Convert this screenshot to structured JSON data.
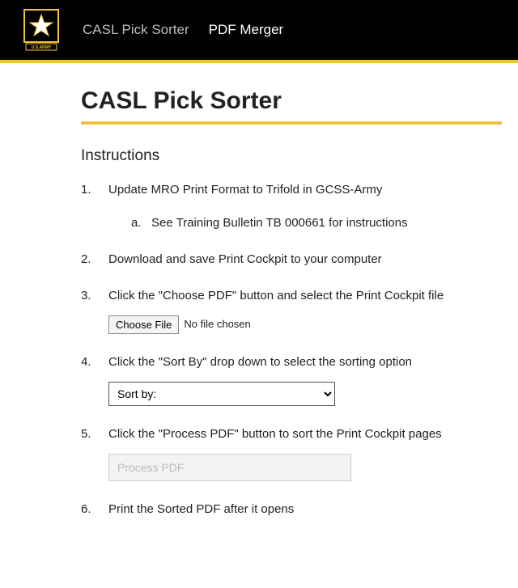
{
  "header": {
    "logo_label": "U.S.ARMY",
    "nav": [
      {
        "label": "CASL Pick Sorter",
        "active": false
      },
      {
        "label": "PDF Merger",
        "active": true
      }
    ]
  },
  "page": {
    "title": "CASL Pick Sorter",
    "instructions_heading": "Instructions"
  },
  "steps": {
    "s1": "Update MRO Print Format to Trifold in GCSS-Army",
    "s1a": "See Training Bulletin TB 000661 for instructions",
    "s2": "Download and save Print Cockpit to your computer",
    "s3": "Click the \"Choose PDF\" button and select the Print Cockpit file",
    "s4": "Click the \"Sort By\" drop down to select the sorting option",
    "s5": "Click the \"Process PDF\" button to sort the Print Cockpit pages",
    "s6": "Print the Sorted PDF after it opens"
  },
  "controls": {
    "choose_file_label": "Choose File",
    "file_status": "No file chosen",
    "sort_placeholder": "Sort by:",
    "process_label": "Process PDF"
  }
}
